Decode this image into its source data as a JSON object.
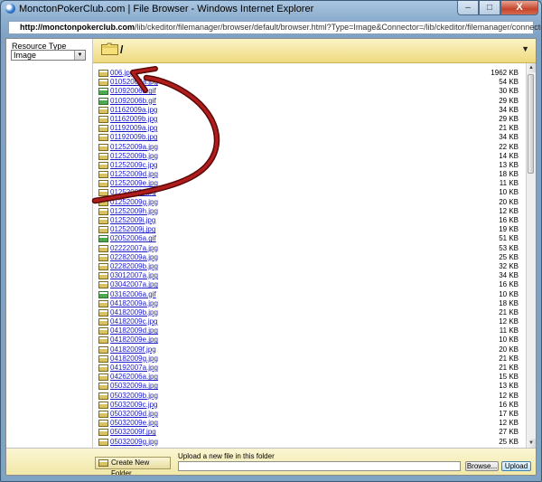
{
  "window": {
    "title": "MonctonPokerClub.com | File Browser - Windows Internet Explorer",
    "address_host": "http://monctonpokerclub.com",
    "address_path": "/lib/ckeditor/filemanager/browser/default/browser.html?Type=Image&Connector=/lib/ckeditor/filemanager/connectors/php/connector.php&",
    "controls": {
      "minimize": "–",
      "maximize": "□",
      "close": "X"
    }
  },
  "sidebar": {
    "resource_type_label": "Resource Type",
    "resource_type_value": "Image"
  },
  "folder": {
    "path": "/"
  },
  "files": [
    {
      "name": "006.jpg",
      "size": "1962 KB",
      "type": "jpg"
    },
    {
      "name": "01052009a.jpg",
      "size": "54 KB",
      "type": "jpg"
    },
    {
      "name": "01092006a.gif",
      "size": "30 KB",
      "type": "gif"
    },
    {
      "name": "01092006b.gif",
      "size": "29 KB",
      "type": "gif"
    },
    {
      "name": "01162009a.jpg",
      "size": "34 KB",
      "type": "jpg"
    },
    {
      "name": "01162009b.jpg",
      "size": "29 KB",
      "type": "jpg"
    },
    {
      "name": "01192009a.jpg",
      "size": "21 KB",
      "type": "jpg"
    },
    {
      "name": "01192009b.jpg",
      "size": "34 KB",
      "type": "jpg"
    },
    {
      "name": "01252009a.jpg",
      "size": "22 KB",
      "type": "jpg"
    },
    {
      "name": "01252009b.jpg",
      "size": "14 KB",
      "type": "jpg"
    },
    {
      "name": "01252009c.jpg",
      "size": "13 KB",
      "type": "jpg"
    },
    {
      "name": "01252009d.jpg",
      "size": "18 KB",
      "type": "jpg"
    },
    {
      "name": "01252009e.jpg",
      "size": "11 KB",
      "type": "jpg"
    },
    {
      "name": "01252009f.jpg",
      "size": "10 KB",
      "type": "jpg"
    },
    {
      "name": "01252009g.jpg",
      "size": "20 KB",
      "type": "jpg"
    },
    {
      "name": "01252009h.jpg",
      "size": "12 KB",
      "type": "jpg"
    },
    {
      "name": "01252009i.jpg",
      "size": "16 KB",
      "type": "jpg"
    },
    {
      "name": "01252009j.jpg",
      "size": "19 KB",
      "type": "jpg"
    },
    {
      "name": "02052006a.gif",
      "size": "51 KB",
      "type": "gif"
    },
    {
      "name": "02222007a.jpg",
      "size": "53 KB",
      "type": "jpg"
    },
    {
      "name": "02282009a.jpg",
      "size": "25 KB",
      "type": "jpg"
    },
    {
      "name": "02282009b.jpg",
      "size": "32 KB",
      "type": "jpg"
    },
    {
      "name": "03012007a.jpg",
      "size": "34 KB",
      "type": "jpg"
    },
    {
      "name": "03042007a.jpg",
      "size": "16 KB",
      "type": "jpg"
    },
    {
      "name": "03162006a.gif",
      "size": "10 KB",
      "type": "gif"
    },
    {
      "name": "04182009a.jpg",
      "size": "18 KB",
      "type": "jpg"
    },
    {
      "name": "04182009b.jpg",
      "size": "21 KB",
      "type": "jpg"
    },
    {
      "name": "04182009c.jpg",
      "size": "12 KB",
      "type": "jpg"
    },
    {
      "name": "04182009d.jpg",
      "size": "11 KB",
      "type": "jpg"
    },
    {
      "name": "04182009e.jpg",
      "size": "10 KB",
      "type": "jpg"
    },
    {
      "name": "04182009f.jpg",
      "size": "20 KB",
      "type": "jpg"
    },
    {
      "name": "04182009g.jpg",
      "size": "21 KB",
      "type": "jpg"
    },
    {
      "name": "04192007a.jpg",
      "size": "21 KB",
      "type": "jpg"
    },
    {
      "name": "04262006a.jpg",
      "size": "15 KB",
      "type": "jpg"
    },
    {
      "name": "05032009a.jpg",
      "size": "13 KB",
      "type": "jpg"
    },
    {
      "name": "05032009b.jpg",
      "size": "12 KB",
      "type": "jpg"
    },
    {
      "name": "05032009c.jpg",
      "size": "16 KB",
      "type": "jpg"
    },
    {
      "name": "05032009d.jpg",
      "size": "17 KB",
      "type": "jpg"
    },
    {
      "name": "05032009e.jpg",
      "size": "12 KB",
      "type": "jpg"
    },
    {
      "name": "05032009f.jpg",
      "size": "27 KB",
      "type": "jpg"
    },
    {
      "name": "05032009g.jpg",
      "size": "25 KB",
      "type": "jpg"
    }
  ],
  "bottom": {
    "create_folder_label": "Create New Folder",
    "upload_label": "Upload a new file in this folder",
    "browse_label": "Browse...",
    "upload_button_label": "Upload"
  },
  "colors": {
    "annotation_arrow": "#8b1212",
    "link": "#1a1ac8",
    "folder_bar": "#eed97f"
  }
}
